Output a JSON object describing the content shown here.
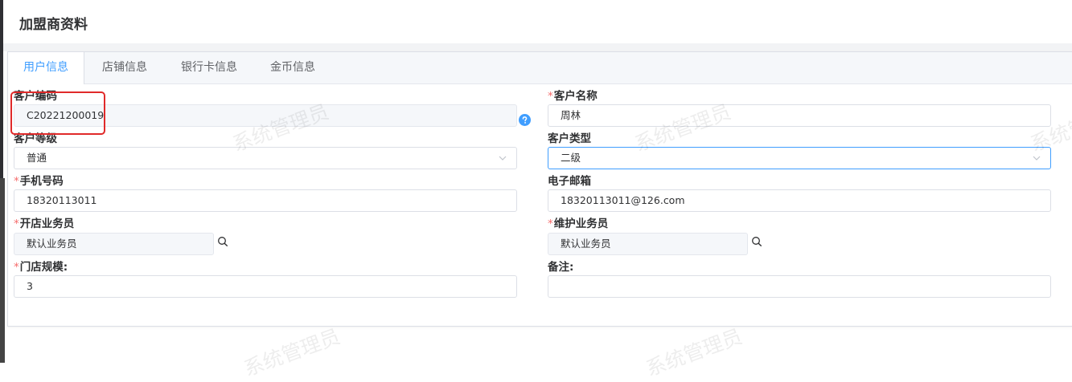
{
  "page": {
    "title": "加盟商资料"
  },
  "tabs": [
    {
      "label": "用户信息",
      "active": true
    },
    {
      "label": "店铺信息",
      "active": false
    },
    {
      "label": "银行卡信息",
      "active": false
    },
    {
      "label": "金币信息",
      "active": false
    }
  ],
  "form": {
    "customer_code": {
      "label": "客户编码",
      "value": "C20221200019"
    },
    "customer_name": {
      "label": "客户名称",
      "value": "周林"
    },
    "customer_level": {
      "label": "客户等级",
      "value": "普通"
    },
    "customer_type": {
      "label": "客户类型",
      "value": "二级"
    },
    "phone": {
      "label": "手机号码",
      "value": "18320113011"
    },
    "email": {
      "label": "电子邮箱",
      "value": "18320113011@126.com"
    },
    "open_salesperson": {
      "label": "开店业务员",
      "value": "默认业务员"
    },
    "maintain_salesperson": {
      "label": "维护业务员",
      "value": "默认业务员"
    },
    "store_scale": {
      "label": "门店规模:",
      "value": "3"
    },
    "remark": {
      "label": "备注:",
      "value": ""
    }
  },
  "required_mark": "*",
  "watermark": {
    "text": "系统管理员"
  },
  "colors": {
    "accent": "#409eff",
    "required": "#f56c6c",
    "highlight": "#e02a2a"
  },
  "icons": {
    "help": "question-circle-icon",
    "search": "search-icon",
    "select": "chevron-down-icon"
  }
}
